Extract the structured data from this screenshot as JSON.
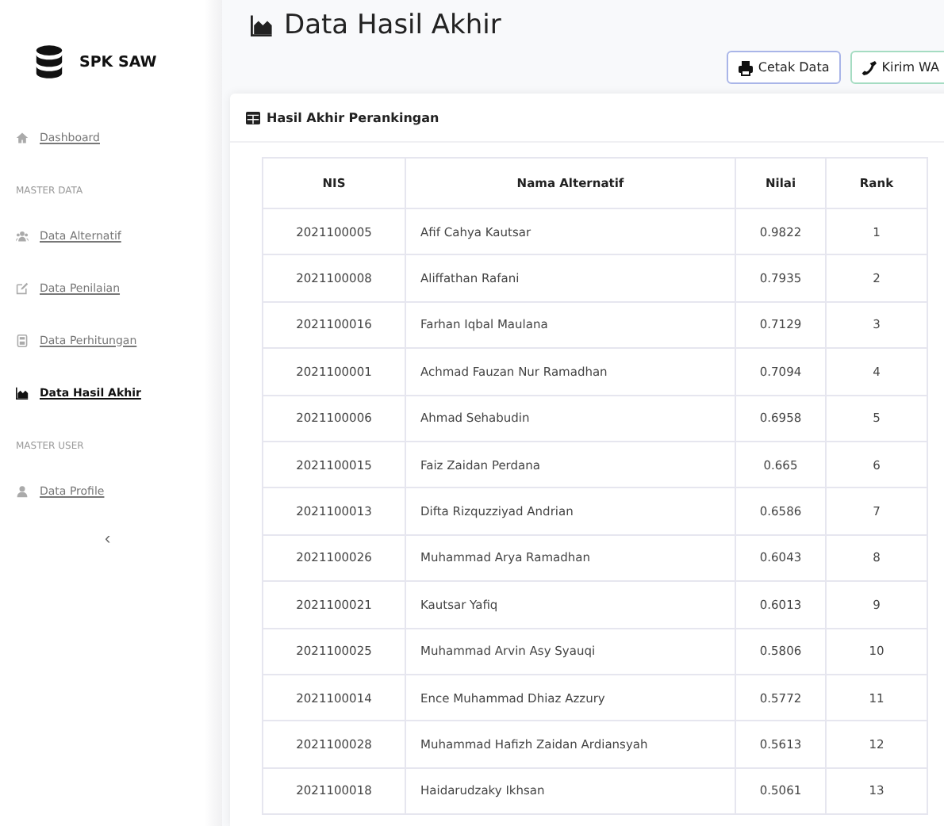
{
  "brand": "SPK SAW",
  "sidebar": {
    "items": [
      {
        "kind": "link",
        "label": "Dashboard",
        "selected": false
      },
      {
        "kind": "heading",
        "label": "MASTER DATA"
      },
      {
        "kind": "link",
        "label": "Data Alternatif",
        "selected": false
      },
      {
        "kind": "link",
        "label": "Data Penilaian",
        "selected": false
      },
      {
        "kind": "link",
        "label": "Data Perhitungan",
        "selected": false
      },
      {
        "kind": "link",
        "label": "Data Hasil Akhir",
        "selected": true
      },
      {
        "kind": "heading",
        "label": "MASTER USER"
      },
      {
        "kind": "link",
        "label": "Data Profile",
        "selected": false
      }
    ],
    "toggle": "‹"
  },
  "page_title": "Data Hasil Akhir",
  "buttons": [
    {
      "kind": "print",
      "label": "Cetak Data"
    },
    {
      "kind": "phone",
      "label": "Kirim WA"
    }
  ],
  "card": {
    "title": "Hasil Akhir Perankingan",
    "table": {
      "columns": [
        "NIS",
        "Nama Alternatif",
        "Nilai",
        "Rank"
      ],
      "rows": [
        [
          "2021100005",
          "Afif Cahya Kautsar",
          "0.9822",
          "1"
        ],
        [
          "2021100008",
          "Aliffathan Rafani",
          "0.7935",
          "2"
        ],
        [
          "2021100016",
          "Farhan Iqbal Maulana",
          "0.7129",
          "3"
        ],
        [
          "2021100001",
          "Achmad Fauzan Nur Ramadhan",
          "0.7094",
          "4"
        ],
        [
          "2021100006",
          "Ahmad Sehabudin",
          "0.6958",
          "5"
        ],
        [
          "2021100015",
          "Faiz Zaidan Perdana",
          "0.665",
          "6"
        ],
        [
          "2021100013",
          "Difta Rizquzziyad Andrian",
          "0.6586",
          "7"
        ],
        [
          "2021100026",
          "Muhammad Arya Ramadhan",
          "0.6043",
          "8"
        ],
        [
          "2021100021",
          "Kautsar Yafiq",
          "0.6013",
          "9"
        ],
        [
          "2021100025",
          "Muhammad Arvin Asy Syauqi",
          "0.5806",
          "10"
        ],
        [
          "2021100014",
          "Ence Muhammad Dhiaz Azzury",
          "0.5772",
          "11"
        ],
        [
          "2021100028",
          "Muhammad Hafizh Zaidan Ardiansyah",
          "0.5613",
          "12"
        ],
        [
          "2021100018",
          "Haidarudzaky Ikhsan",
          "0.5061",
          "13"
        ]
      ]
    }
  }
}
